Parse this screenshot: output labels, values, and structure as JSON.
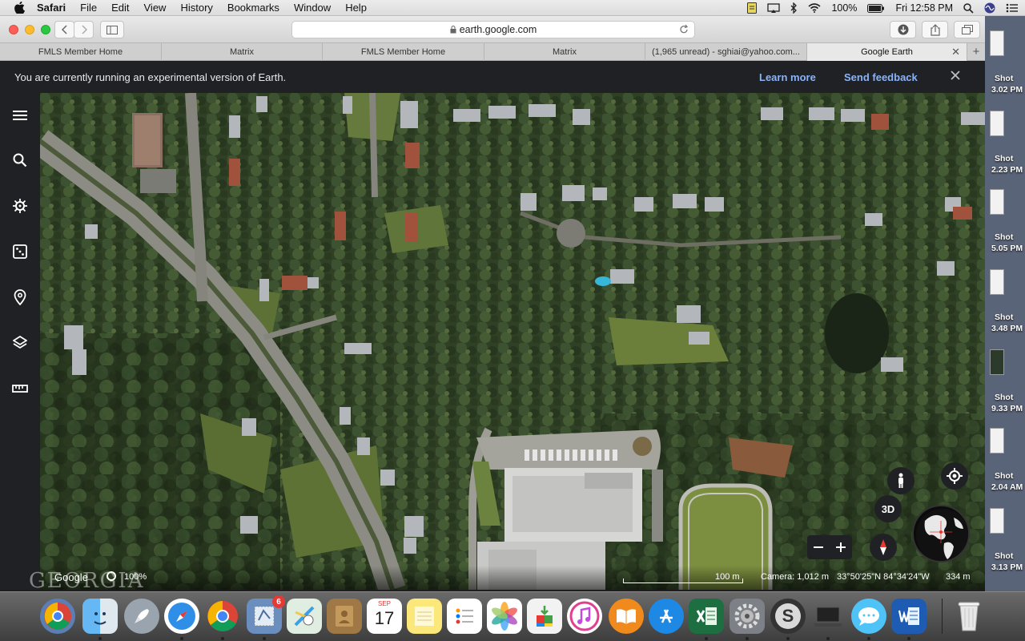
{
  "menubar": {
    "app": "Safari",
    "items": [
      "File",
      "Edit",
      "View",
      "History",
      "Bookmarks",
      "Window",
      "Help"
    ],
    "battery": "100%",
    "clock": "Fri 12:58 PM"
  },
  "browser": {
    "url": "earth.google.com",
    "tabs": [
      {
        "label": "FMLS Member Home"
      },
      {
        "label": "Matrix"
      },
      {
        "label": "FMLS Member Home"
      },
      {
        "label": "Matrix"
      },
      {
        "label": "(1,965 unread) - sghiai@yahoo.com..."
      },
      {
        "label": "Google Earth"
      }
    ]
  },
  "banner": {
    "message": "You are currently running an experimental version of Earth.",
    "learn_more": "Learn more",
    "send_feedback": "Send feedback"
  },
  "map_controls": {
    "three_d": "3D"
  },
  "status": {
    "brand": "Google",
    "zoom": "100%",
    "scale": "100 m",
    "camera": "Camera: 1,012 m",
    "coords": "33°50'25\"N 84°34'24\"W",
    "altitude": "334 m"
  },
  "desktop": {
    "shots": [
      {
        "title": "Shot",
        "time": "3.02 PM"
      },
      {
        "title": "Shot",
        "time": "2.23 PM"
      },
      {
        "title": "Shot",
        "time": "5.05 PM"
      },
      {
        "title": "Shot",
        "time": "3.48 PM"
      },
      {
        "title": "Shot",
        "time": "9.33 PM"
      },
      {
        "title": "Shot",
        "time": "2.04 AM"
      },
      {
        "title": "Shot",
        "time": "3.13 PM"
      }
    ]
  },
  "dock": {
    "calendar_month": "SEP",
    "calendar_day": "17",
    "mail_badge": "6"
  },
  "watermark": "GEORGIA"
}
